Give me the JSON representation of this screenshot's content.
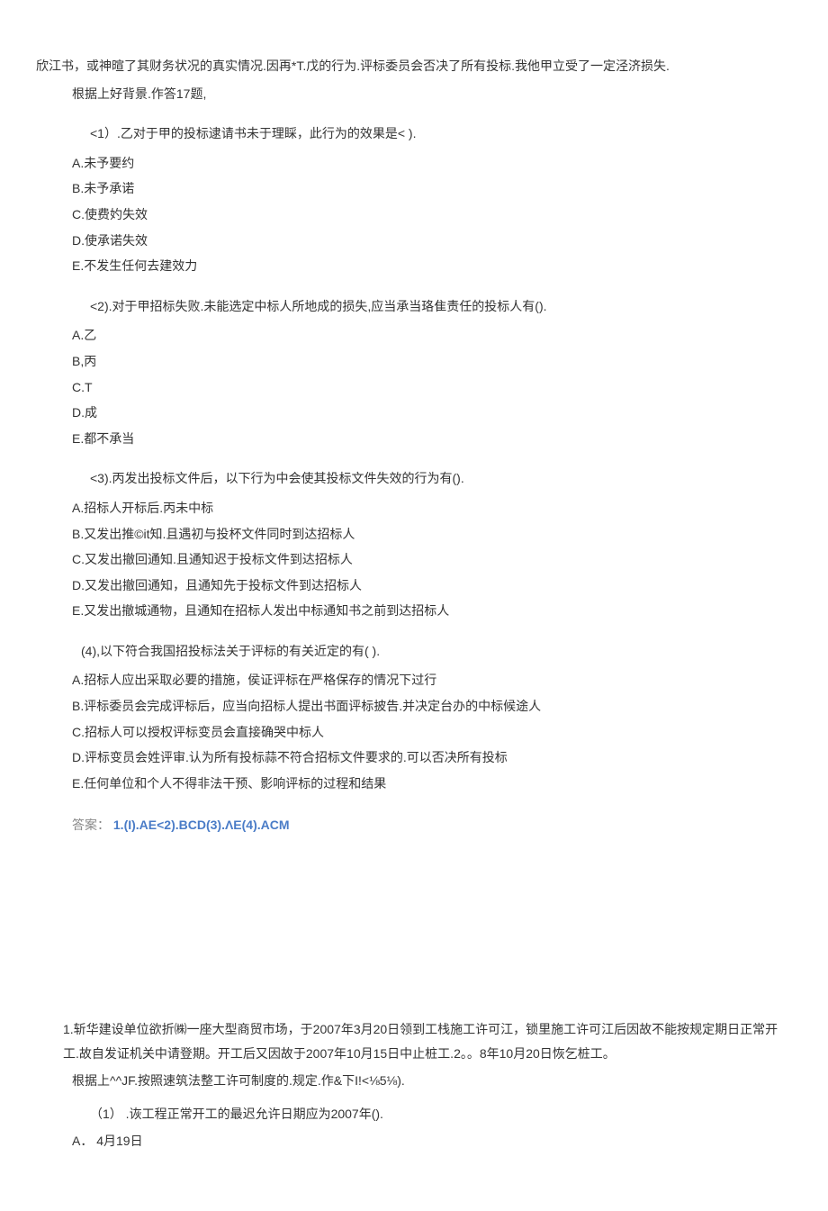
{
  "intro1": "欣江书，或神暄了其财务状况的真实情况.因再*T.戊的行为.评标委员会否决了所有投标.我他甲立受了一定泾济损失.",
  "intro2": "根据上好背景.作答17题,",
  "q1": {
    "stem": "<1）.乙对于甲的投标逮请书未于理睬，此行为的效果是<               ).",
    "options": {
      "a": "A.未予要约",
      "b": "B.未予承诺",
      "c": "C.使费妁失效",
      "d": "D.使承诺失效",
      "e": "E.不发生任何去建效力"
    }
  },
  "q2": {
    "stem": "<2).对于甲招标失败.未能选定中标人所地成的损失,应当承当珞隹责任的投标人有().",
    "options": {
      "a": "A.乙",
      "b": "B,丙",
      "c": "C.T",
      "d": "D.成",
      "e": "E.都不承当"
    }
  },
  "q3": {
    "stem": "<3).丙发出投标文件后，以下行为中会使其投标文件失效的行为有().",
    "options": {
      "a": "A.招标人开标后.丙未中标",
      "b": "B.又发出推©it知.且遇初与投杯文件同时到达招标人",
      "c": "C.又发出撤回通知.且通知迟于投标文件到达招标人",
      "d": "D.又发出撤回通知，且通知先于投标文件到达招标人",
      "e": "E.又发出撤城通物，且通知在招标人发出中标通知书之前到达招标人"
    }
  },
  "q4": {
    "stem": "(4),以下符合我国招投标法关于评标的有关近定的有(                     ).",
    "options": {
      "a": "A.招标人应出采取必要的措施，侯证评标在严格保存的情况下过行",
      "b": "B.评标委员会完成评标后，应当向招标人提出书面评标披告.并决定台办的中标候途人",
      "c": "C.招标人可以授权评标变员会直接确哭中标人",
      "d": "D.评标变员会姓评审.认为所有投标蒜不符合招标文件要求的.可以否决所有投标",
      "e": "E.任何单位和个人不得非法干预、影响评标的过程和结果"
    }
  },
  "answer": {
    "label": "答案：",
    "value": "1.(I).AE<2).BCD(3).ΛE(4).ACM"
  },
  "section2": {
    "para1": "1.斩华建设单位欲折㈱一座大型商贸市场，于2007年3月20日领到工栈施工许可江，锁里施工许可江后因故不能按规定期日正常开工.故自发证机关中请登期。开工后又因故于2007年10月15日中止桩工.2。。8年10月20日恢乞桩工。",
    "para2": "根据上^^JF.按照速筑法整工许可制度的.规定.作&下I!<⅛5⅛).",
    "q1stem": "（1）  .诙工程正常开工的最迟允许日期应为2007年().",
    "q1a": "A．   4月19日"
  }
}
